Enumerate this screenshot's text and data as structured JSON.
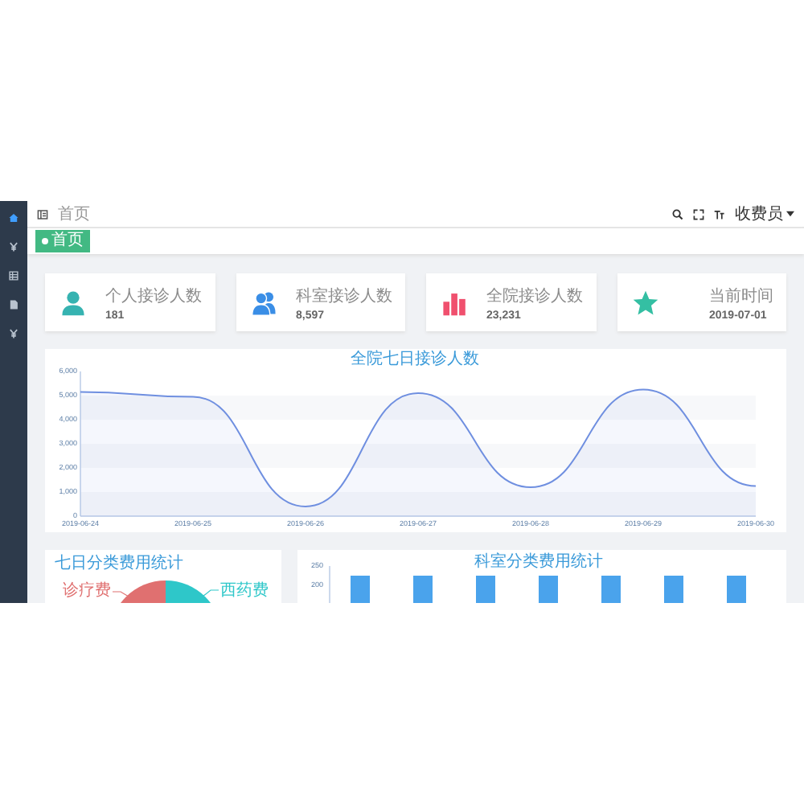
{
  "sidebar": {
    "items": [
      {
        "kind": "home",
        "selected": true
      },
      {
        "kind": "yen",
        "selected": false
      },
      {
        "kind": "table",
        "selected": false
      },
      {
        "kind": "document",
        "selected": false
      },
      {
        "kind": "yen",
        "selected": false
      }
    ]
  },
  "topbar": {
    "breadcrumb": "首页",
    "user": "收费员"
  },
  "tags": [
    {
      "label": "首页",
      "selected": true
    }
  ],
  "cards": [
    {
      "kind": "person",
      "color": "#36b3b1",
      "label": "个人接诊人数",
      "value": "181"
    },
    {
      "kind": "people",
      "color": "#3a8ee6",
      "label": "科室接诊人数",
      "value": "8,597"
    },
    {
      "kind": "bars",
      "color": "#f0506e",
      "label": "全院接诊人数",
      "value": "23,231"
    },
    {
      "kind": "star",
      "color": "#34bfa3",
      "label": "当前时间",
      "value": "2019-07-01"
    }
  ],
  "line_panel": {
    "chart_data": {
      "type": "area",
      "title": "全院七日接诊人数",
      "categories": [
        "2019-06-24",
        "2019-06-25",
        "2019-06-26",
        "2019-06-27",
        "2019-06-28",
        "2019-06-29",
        "2019-06-30"
      ],
      "series": [
        {
          "color": "#6f8fe0",
          "values": [
            5150,
            4950,
            400,
            5100,
            1200,
            5250,
            1250
          ]
        }
      ],
      "ylim": [
        0,
        6000
      ],
      "yticks": [
        {
          "value": 0,
          "label": "0"
        },
        {
          "value": 1000,
          "label": "1,000"
        },
        {
          "value": 2000,
          "label": "2,000"
        },
        {
          "value": 3000,
          "label": "3,000"
        },
        {
          "value": 4000,
          "label": "4,000"
        },
        {
          "value": 5000,
          "label": "5,000"
        },
        {
          "value": 6000,
          "label": "6,000"
        }
      ]
    }
  },
  "pie_panel": {
    "title": "七日分类费用统计",
    "labels": [
      "诊疗费",
      "西药费"
    ]
  },
  "bar_panel": {
    "title": "科室分类费用统计",
    "axis_labels": [
      "250",
      "200"
    ]
  }
}
